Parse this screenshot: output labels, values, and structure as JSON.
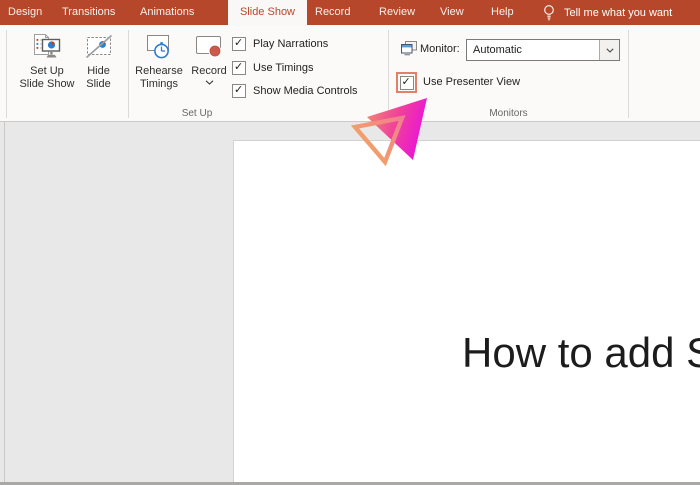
{
  "colors": {
    "ribbon_red": "#B7472A",
    "selected_tab_text": "#B7472A",
    "presenter_highlight": "#E0816B",
    "record_dot": "#CC5A4A",
    "icon_blue": "#2B7CD3",
    "icon_red": "#C43E1C",
    "logo_gradient": [
      "#F28B6E",
      "#F0409C",
      "#E90DE0"
    ]
  },
  "tab_bar": {
    "tabs": [
      {
        "label": "Design",
        "selected": false
      },
      {
        "label": "Transitions",
        "selected": false
      },
      {
        "label": "Animations",
        "selected": false
      },
      {
        "label": "Slide Show",
        "selected": true
      },
      {
        "label": "Record",
        "selected": false
      },
      {
        "label": "Review",
        "selected": false
      },
      {
        "label": "View",
        "selected": false
      },
      {
        "label": "Help",
        "selected": false
      }
    ],
    "tell_me": "Tell me what you want",
    "tell_me_icon": "lightbulb-icon"
  },
  "ribbon": {
    "set_up_group": {
      "label": "Set Up",
      "setup_slideshow": {
        "line1": "Set Up",
        "line2": "Slide Show",
        "icon": "set-up-slide-show-icon"
      },
      "hide_slide": {
        "line1": "Hide",
        "line2": "Slide",
        "icon": "hide-slide-icon"
      },
      "rehearse_timings": {
        "line1": "Rehearse",
        "line2": "Timings",
        "icon": "rehearse-timings-icon"
      },
      "record": {
        "label": "Record",
        "has_dropdown": true,
        "icon": "record-icon"
      },
      "checkboxes": [
        {
          "label": "Play Narrations",
          "checked": true
        },
        {
          "label": "Use Timings",
          "checked": true
        },
        {
          "label": "Show Media Controls",
          "checked": true
        }
      ]
    },
    "monitors_group": {
      "label": "Monitors",
      "monitor_label": "Monitor:",
      "monitor_value": "Automatic",
      "monitor_icon": "monitor-icon",
      "use_presenter_view": {
        "label": "Use Presenter View",
        "checked": true,
        "highlighted": true
      }
    }
  },
  "slide": {
    "title": "How to add Sp"
  }
}
